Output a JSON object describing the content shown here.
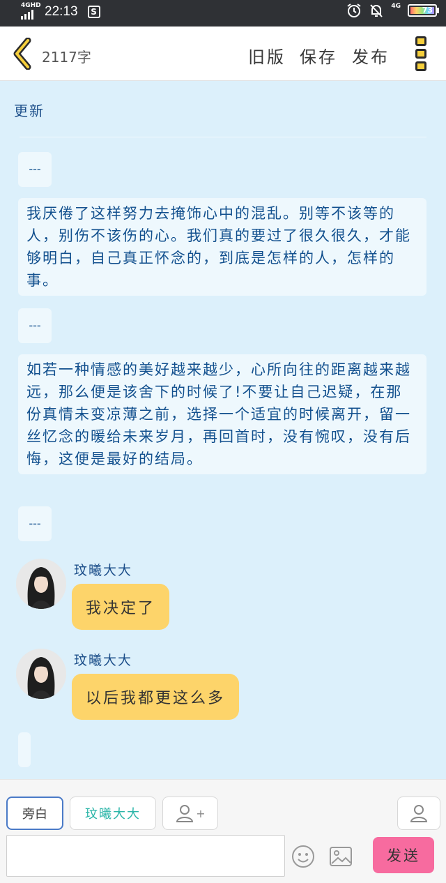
{
  "status_bar": {
    "network": "4GHD",
    "time": "22:13",
    "s_badge": "S",
    "network_right": "4G",
    "battery_level": "73"
  },
  "header": {
    "word_count": "2117字",
    "old_version": "旧版",
    "save": "保存",
    "publish": "发布"
  },
  "content": {
    "title": "更新",
    "separator": "---",
    "paragraphs": [
      "我厌倦了这样努力去掩饰心中的混乱。别等不该等的人，别伤不该伤的心。我们真的要过了很久很久，才能够明白，自己真正怀念的，到底是怎样的人，怎样的事。",
      "如若一种情感的美好越来越少，心所向往的距离越来越远，那么便是该舍下的时候了!不要让自己迟疑，在那份真情未变凉薄之前，选择一个适宜的时候离开，留一丝忆念的暖给未来岁月，再回首时，没有惋叹，没有后悔，这便是最好的结局。"
    ],
    "messages": [
      {
        "name": "玟曦大大",
        "text": "我决定了"
      },
      {
        "name": "玟曦大大",
        "text": "以后我都更这么多"
      }
    ]
  },
  "bottom_bar": {
    "aside_button": "旁白",
    "character_button": "玟曦大大",
    "add_character_plus": "+",
    "input_value": "",
    "input_placeholder": "",
    "send_button": "发送"
  },
  "colors": {
    "background": "#dcf0fb",
    "text_blue": "#12508e",
    "bubble": "#fdd46a",
    "send": "#f76b9f",
    "accent_teal": "#2ab5a8"
  }
}
